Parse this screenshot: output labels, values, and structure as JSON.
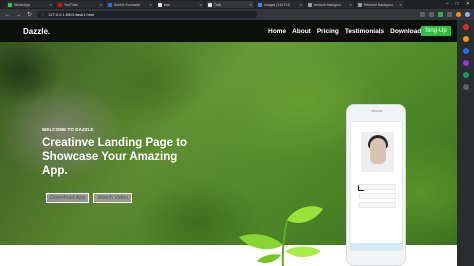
{
  "browser": {
    "tabs": [
      {
        "title": "WhatsApp",
        "color": "#25d366",
        "active": false
      },
      {
        "title": "YouTube",
        "color": "#ff0000",
        "active": false
      },
      {
        "title": "Sachin Kushwah",
        "color": "#1877f2",
        "active": false
      },
      {
        "title": "task",
        "color": "#e8eaed",
        "active": false
      },
      {
        "title": "Task",
        "color": "#e8eaed",
        "active": true
      },
      {
        "title": "images (1417×3)",
        "color": "#4285f4",
        "active": false
      },
      {
        "title": "remove backgrou",
        "color": "#9aa0a6",
        "active": false
      },
      {
        "title": "Remove Backgrou",
        "color": "#9aa0a6",
        "active": false
      }
    ],
    "url": "127.0.0.1:5501/task1.html",
    "info_icon": "ⓘ",
    "back_icon": "←",
    "forward_icon": "→",
    "reload_icon": "↻",
    "window_controls": {
      "minimize": "–",
      "maximize": "□",
      "close": "✕"
    }
  },
  "site": {
    "brand": "Dazzle.",
    "nav": [
      "Home",
      "About",
      "Pricing",
      "Testimonials",
      "Download"
    ],
    "signup": "Sing-Up",
    "welcome": "WELCOME TO DAZZLE",
    "headline": "Creatinve Landing Page to Showcase Your Amazing App.",
    "buttons": {
      "download": "Download App",
      "watch": "Watch Video"
    }
  },
  "colors": {
    "accent_green": "#2bbf3a",
    "navbar": "#0d0f0c",
    "button_text": "#5a4a8a"
  }
}
